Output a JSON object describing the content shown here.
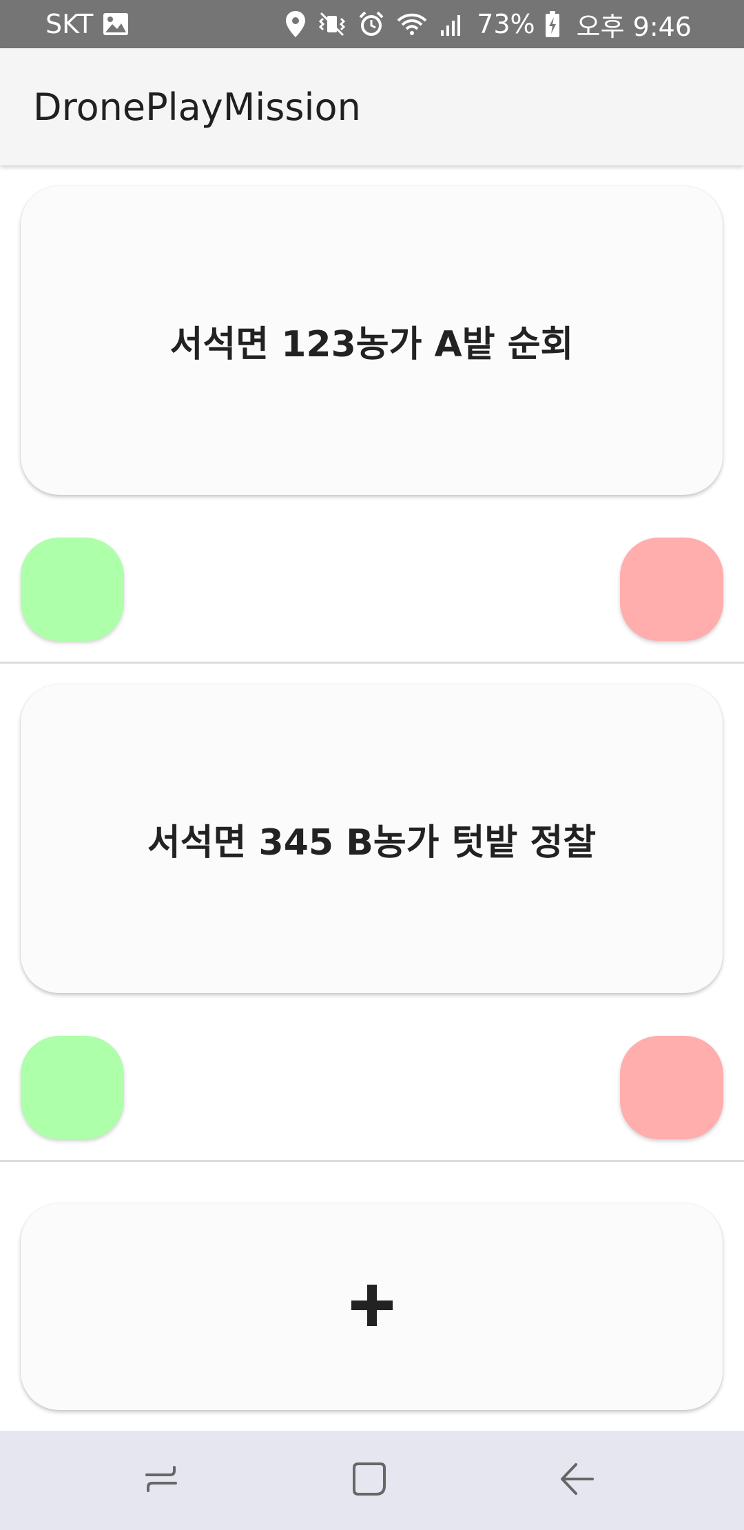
{
  "status_bar": {
    "carrier": "SKT",
    "battery_percent": "73%",
    "time": "오후 9:46",
    "icons": [
      "gallery-icon",
      "location-icon",
      "vibrate-icon",
      "alarm-icon",
      "wifi-icon",
      "signal-icon",
      "battery-charging-icon"
    ]
  },
  "app_bar": {
    "title": "DronePlayMission"
  },
  "missions": [
    {
      "title": "서석면 123농가 A밭 순회",
      "start_color": "#adffa9",
      "delete_color": "#ffadad"
    },
    {
      "title": "서석면 345 B농가 텃밭 정찰",
      "start_color": "#adffa9",
      "delete_color": "#ffadad"
    }
  ],
  "add_card": {
    "icon": "plus-icon"
  },
  "nav_bar": {
    "buttons": [
      "recent-apps-icon",
      "home-icon",
      "back-icon"
    ]
  }
}
